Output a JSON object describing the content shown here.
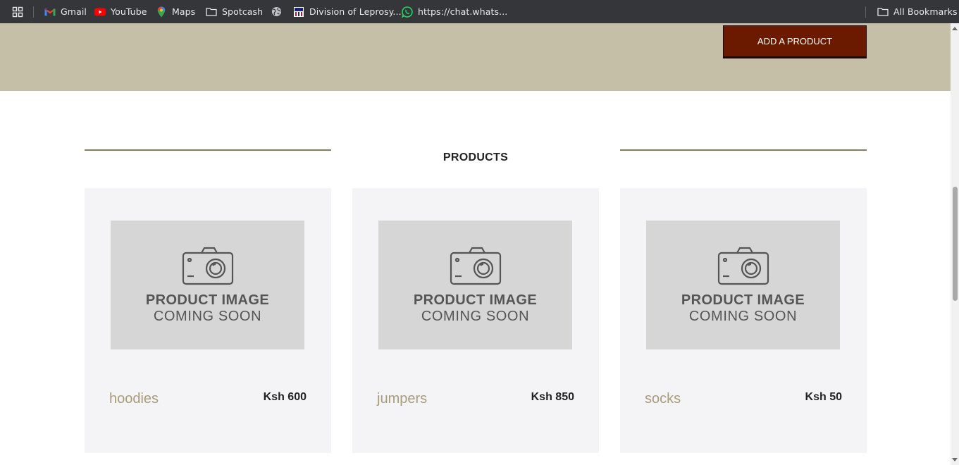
{
  "bookmarks": {
    "items": [
      {
        "label": "Gmail",
        "icon": "gmail-icon"
      },
      {
        "label": "YouTube",
        "icon": "youtube-icon"
      },
      {
        "label": "Maps",
        "icon": "maps-icon"
      },
      {
        "label": "Spotcash",
        "icon": "folder-icon"
      },
      {
        "label": "",
        "icon": "globe-icon"
      },
      {
        "label": "Division of Leprosy...",
        "icon": "site-favicon-icon"
      },
      {
        "label": "https://chat.whats...",
        "icon": "whatsapp-icon"
      }
    ],
    "all_bookmarks": "All Bookmarks"
  },
  "header": {
    "add_product_label": "ADD A PRODUCT"
  },
  "products_section": {
    "title": "PRODUCTS",
    "placeholder_line1": "PRODUCT IMAGE",
    "placeholder_line2": "COMING SOON",
    "items": [
      {
        "name": "hoodies",
        "price": "Ksh 600"
      },
      {
        "name": "jumpers",
        "price": "Ksh 850"
      },
      {
        "name": "socks",
        "price": "Ksh 50"
      }
    ]
  },
  "colors": {
    "hero_bg": "#c6bfa8",
    "button_bg": "#6b1a00",
    "accent_line": "#8b7b61",
    "product_name": "#a99c7b"
  }
}
